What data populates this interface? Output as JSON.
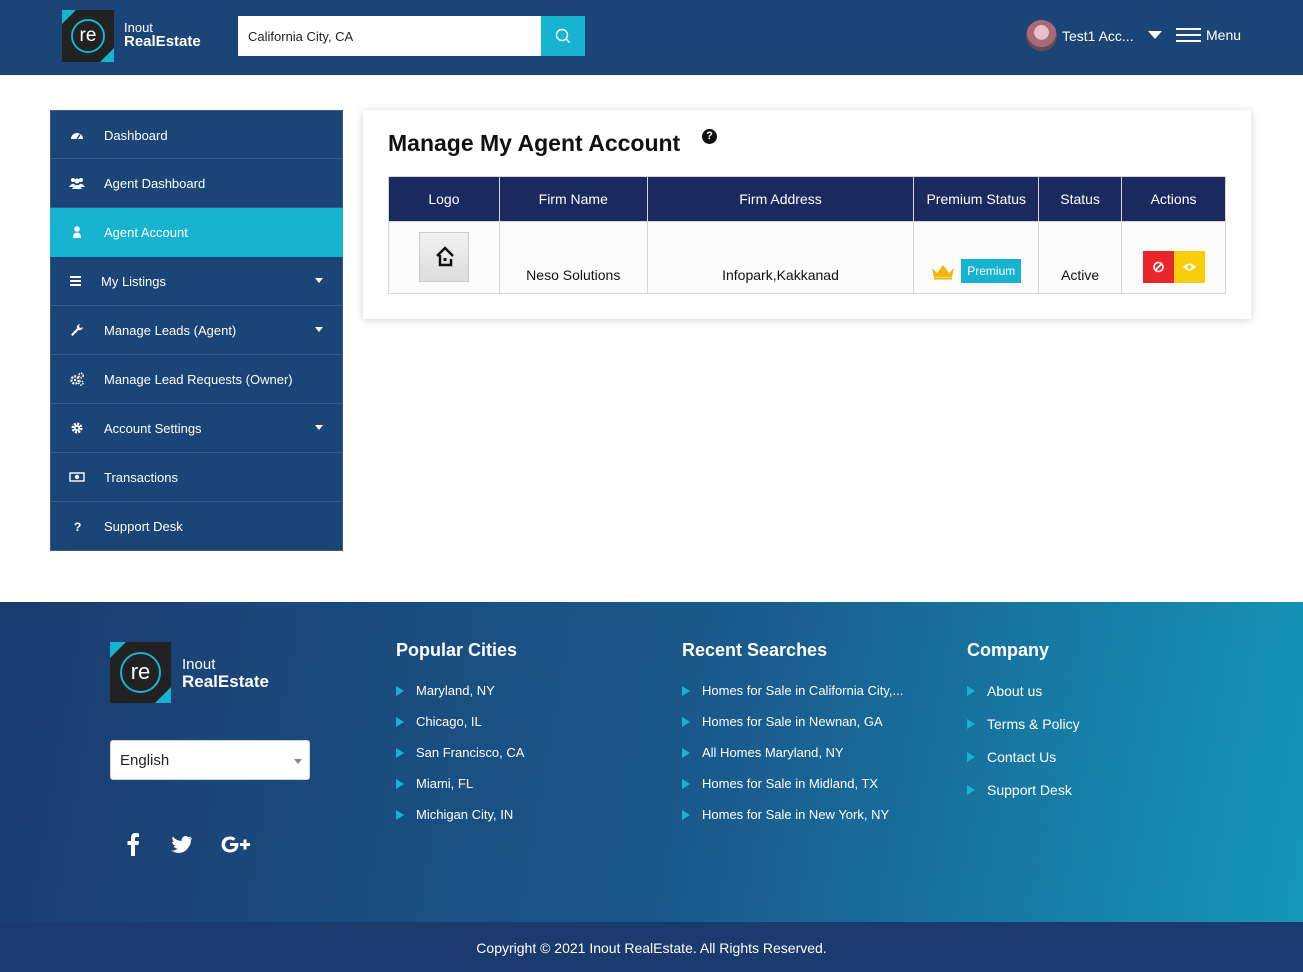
{
  "header": {
    "brand_top": "Inout",
    "brand_bottom": "RealEstate",
    "logo_letters": "re",
    "search_value": "California City, CA",
    "user_name": "Test1 Acc...",
    "menu_label": "Menu"
  },
  "sidebar": {
    "items": [
      {
        "label": "Dashboard",
        "icon": "dashboard-icon"
      },
      {
        "label": "Agent Dashboard",
        "icon": "users-icon"
      },
      {
        "label": "Agent Account",
        "icon": "user-icon",
        "active": true
      },
      {
        "label": "My Listings",
        "icon": "list-icon",
        "has_caret": true
      },
      {
        "label": "Manage Leads (Agent)",
        "icon": "wrench-icon",
        "has_caret": true
      },
      {
        "label": "Manage Lead Requests (Owner)",
        "icon": "cogs-icon"
      },
      {
        "label": "Account Settings",
        "icon": "gear-icon",
        "has_caret": true
      },
      {
        "label": "Transactions",
        "icon": "money-icon"
      },
      {
        "label": "Support Desk",
        "icon": "question-icon"
      }
    ]
  },
  "main": {
    "title": "Manage My Agent Account",
    "help_glyph": "?",
    "table": {
      "headers": [
        "Logo",
        "Firm Name",
        "Firm Address",
        "Premium Status",
        "Status",
        "Actions"
      ],
      "rows": [
        {
          "firm_name": "Neso Solutions",
          "firm_address": "Infopark,Kakkanad",
          "premium": "Premium",
          "status": "Active"
        }
      ]
    }
  },
  "footer": {
    "language": "English",
    "popular_cities": {
      "title": "Popular Cities",
      "links": [
        "Maryland, NY",
        "Chicago, IL",
        "San Francisco, CA",
        "Miami, FL",
        "Michigan City, IN"
      ]
    },
    "recent_searches": {
      "title": "Recent Searches",
      "links": [
        "Homes for Sale in California City,...",
        "Homes for Sale in Newnan, GA",
        "All Homes Maryland, NY",
        "Homes for Sale in Midland, TX",
        "Homes for Sale in New York, NY"
      ]
    },
    "company": {
      "title": "Company",
      "links": [
        "About us",
        "Terms & Policy",
        "Contact Us",
        "Support Desk"
      ]
    },
    "social": [
      "facebook-icon",
      "twitter-icon",
      "google-plus-icon"
    ],
    "copyright": "Copyright © 2021 Inout RealEstate. All Rights Reserved."
  },
  "colors": {
    "navy": "#1b4577",
    "accent": "#17b3d0",
    "table_header": "#1b2a5e",
    "danger": "#e8262b",
    "warning": "#f8cd0c",
    "crown": "#f2b705"
  }
}
